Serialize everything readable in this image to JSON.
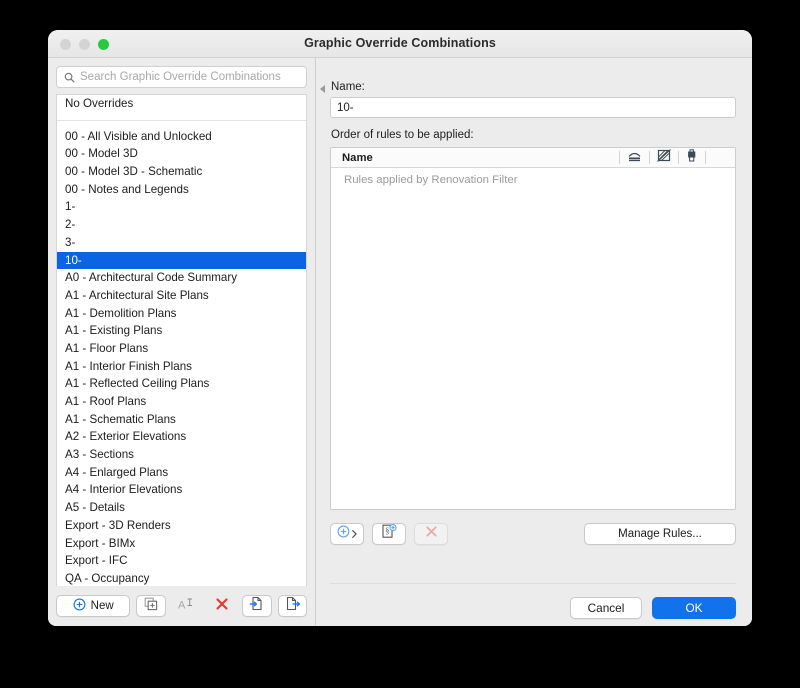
{
  "window": {
    "title": "Graphic Override Combinations",
    "traffic_lights": [
      "close-button",
      "minimize-button",
      "zoom-button"
    ],
    "accent_color": "#1272ec",
    "selection_color": "#0a64e4"
  },
  "sidebar": {
    "search": {
      "placeholder": "Search Graphic Override Combinations",
      "value": "",
      "icon": "search-icon"
    },
    "top_item": "No Overrides",
    "items": [
      "00 - All Visible and Unlocked",
      "00 - Model 3D",
      "00 - Model 3D - Schematic",
      "00 - Notes and Legends",
      "1-",
      "2-",
      "3-",
      "10-",
      "A0 - Architectural Code Summary",
      "A1 - Architectural Site Plans",
      "A1 - Demolition Plans",
      "A1 - Existing Plans",
      "A1 - Floor Plans",
      "A1 - Interior Finish Plans",
      "A1 - Reflected Ceiling Plans",
      "A1 - Roof Plans",
      "A1 - Schematic Plans",
      "A2 - Exterior Elevations",
      "A3 - Sections",
      "A4 - Enlarged Plans",
      "A4 - Interior Elevations",
      "A5 - Details",
      "Export - 3D Renders",
      "Export - BIMx",
      "Export - IFC",
      "QA - Occupancy"
    ],
    "selected_index": 7,
    "toolbar": {
      "new_label": "New",
      "new_icon": "plus-circle-icon",
      "duplicate_icon": "duplicate-icon",
      "rename_icon": "rename-text-icon",
      "delete_icon": "red-x-icon",
      "import_icon": "import-document-icon",
      "export_icon": "export-document-icon"
    }
  },
  "detail": {
    "collapse_icon": "collapse-left-icon",
    "name_label": "Name:",
    "name_value": "10-",
    "order_label": "Order of rules to be applied:",
    "rules_table": {
      "columns": [
        "Name"
      ],
      "column_icons": [
        "pen-weight-icon",
        "fill-pattern-icon",
        "surface-paint-icon"
      ],
      "empty_text": "Rules applied by Renovation Filter",
      "rows": []
    },
    "toolbar": {
      "add_icon": "plus-circle-icon",
      "add_chevron_icon": "chevron-right-icon",
      "new_rule_icon": "new-rule-document-icon",
      "delete_icon": "red-x-icon",
      "manage_label": "Manage Rules..."
    }
  },
  "actions": {
    "cancel_label": "Cancel",
    "ok_label": "OK"
  }
}
